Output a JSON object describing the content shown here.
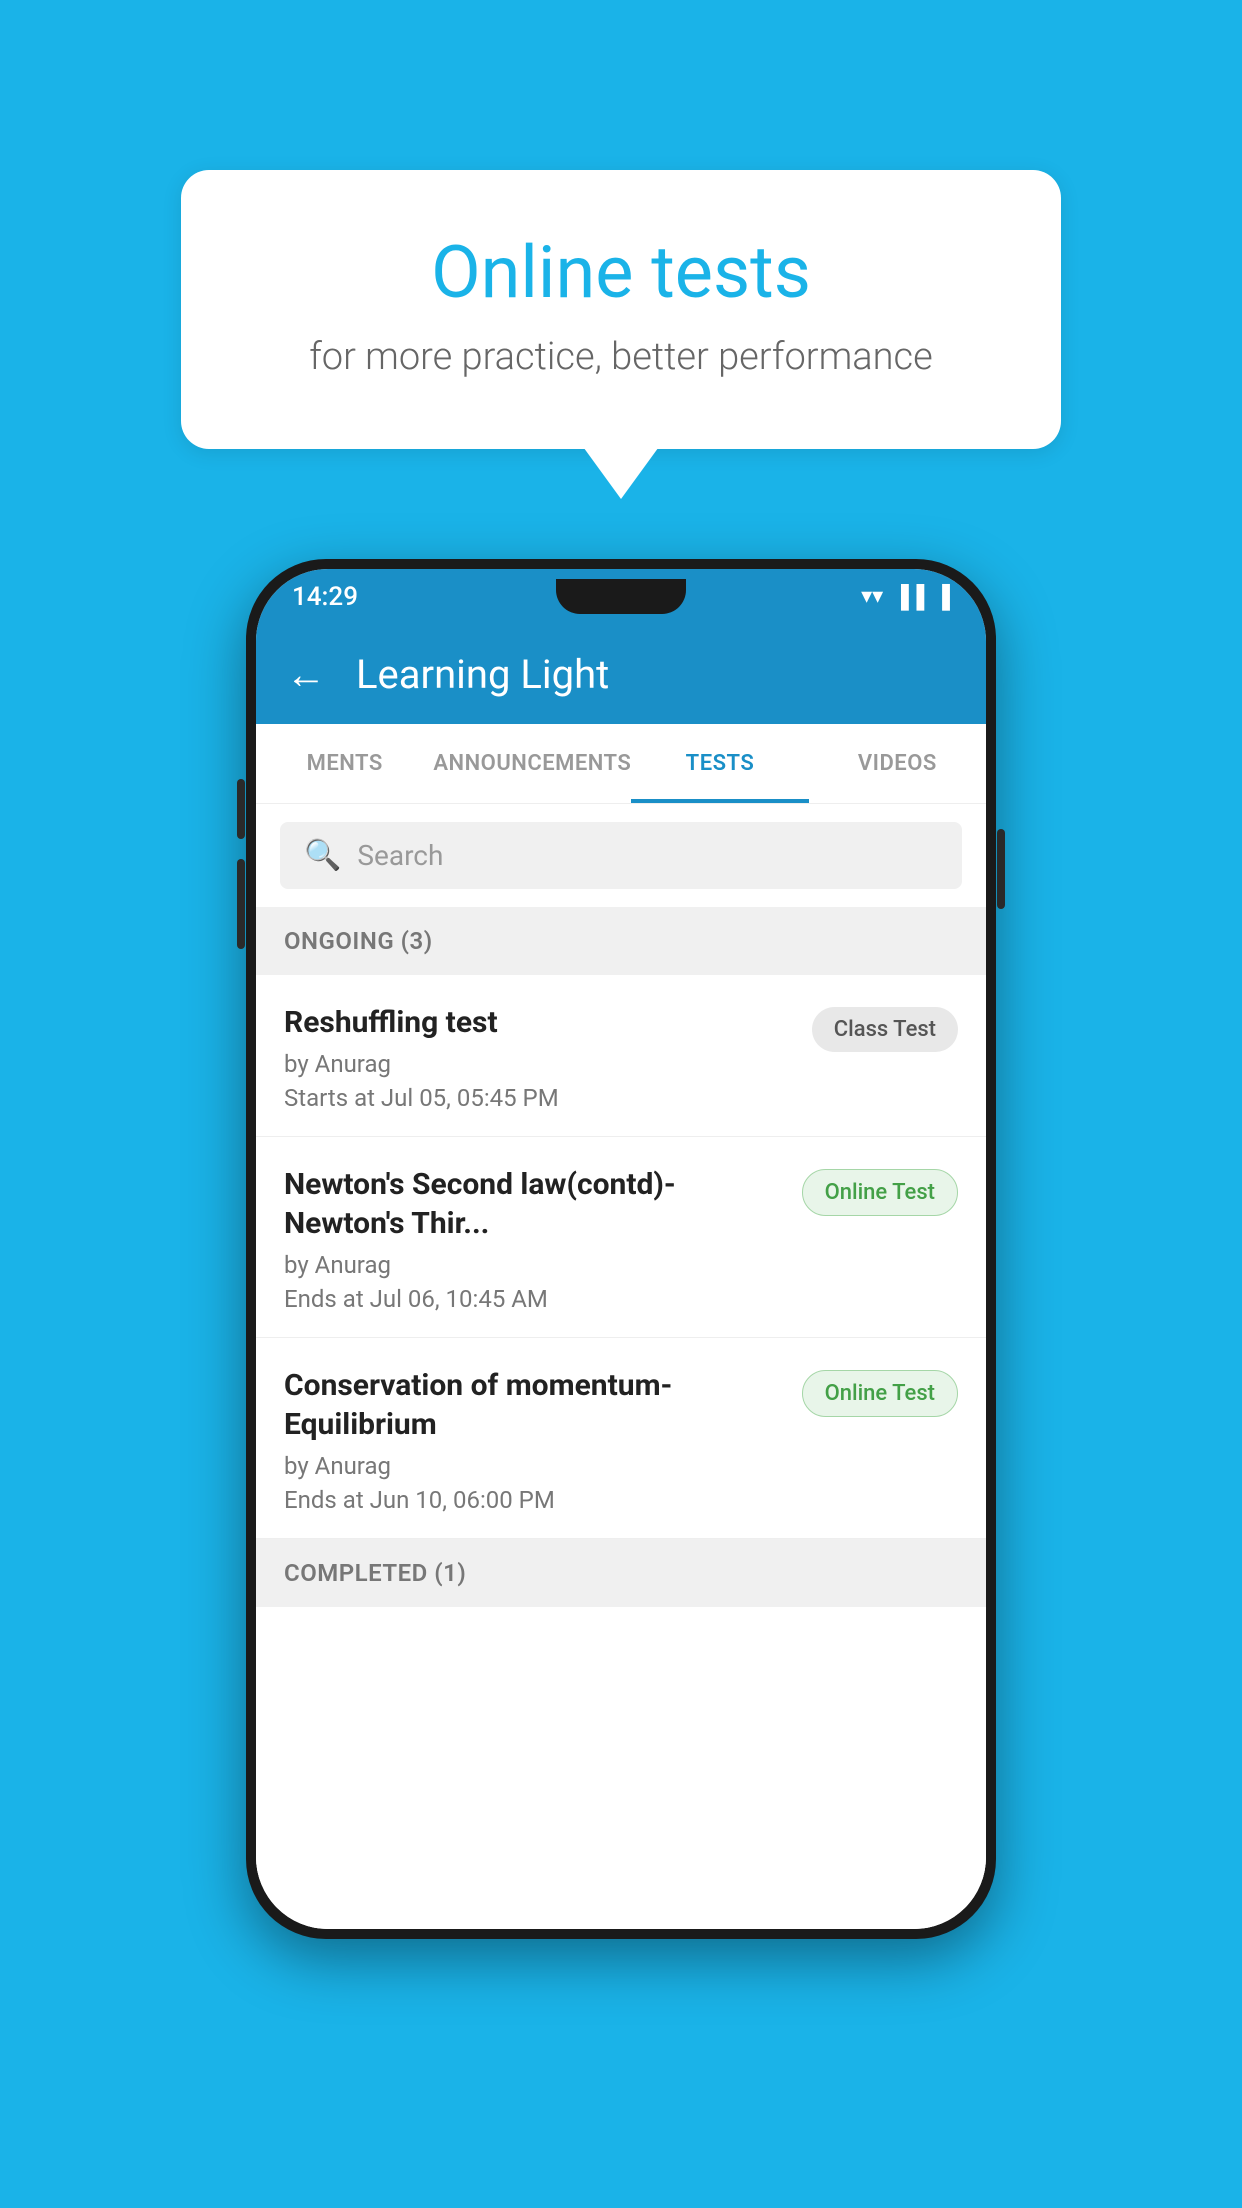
{
  "background_color": "#1ab3e8",
  "speech_bubble": {
    "title": "Online tests",
    "subtitle": "for more practice, better performance"
  },
  "phone": {
    "status_bar": {
      "time": "14:29",
      "icons": [
        "▲",
        "▲",
        "▐"
      ]
    },
    "app_bar": {
      "title": "Learning Light",
      "back_label": "←"
    },
    "tabs": [
      {
        "label": "MENTS",
        "active": false
      },
      {
        "label": "ANNOUNCEMENTS",
        "active": false
      },
      {
        "label": "TESTS",
        "active": true
      },
      {
        "label": "VIDEOS",
        "active": false
      }
    ],
    "search": {
      "placeholder": "Search"
    },
    "sections": [
      {
        "label": "ONGOING (3)",
        "tests": [
          {
            "title": "Reshuffling test",
            "author": "by Anurag",
            "date": "Starts at  Jul 05, 05:45 PM",
            "badge": "Class Test",
            "badge_type": "class"
          },
          {
            "title": "Newton's Second law(contd)-Newton's Thir...",
            "author": "by Anurag",
            "date": "Ends at  Jul 06, 10:45 AM",
            "badge": "Online Test",
            "badge_type": "online"
          },
          {
            "title": "Conservation of momentum-Equilibrium",
            "author": "by Anurag",
            "date": "Ends at  Jun 10, 06:00 PM",
            "badge": "Online Test",
            "badge_type": "online"
          }
        ]
      }
    ],
    "completed_label": "COMPLETED (1)"
  }
}
